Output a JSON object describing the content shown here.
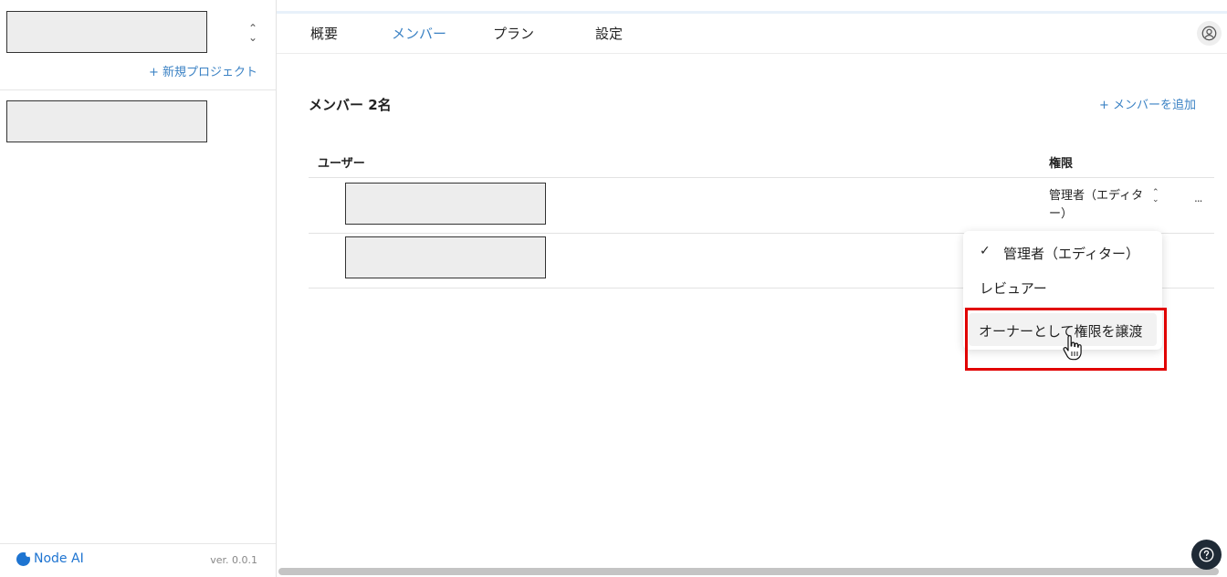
{
  "sidebar": {
    "new_project_label": "+ 新規プロジェクト",
    "logo_text": "Node AI",
    "version": "ver. 0.0.1"
  },
  "nav": {
    "tabs": [
      {
        "label": "概要",
        "active": false
      },
      {
        "label": "メンバー",
        "active": true
      },
      {
        "label": "プラン",
        "active": false
      },
      {
        "label": "設定",
        "active": false
      }
    ]
  },
  "main": {
    "members_title": "メンバー 2名",
    "add_member_label": "+ メンバーを追加",
    "columns": {
      "user": "ユーザー",
      "role": "権限"
    },
    "rows": [
      {
        "role": "管理者（エディター）",
        "more": "..."
      },
      {
        "role": ""
      }
    ]
  },
  "dropdown": {
    "items": [
      {
        "label": "管理者（エディター）",
        "checked": true
      },
      {
        "label": "レビュアー",
        "checked": false
      },
      {
        "label": "オーナーとして権限を譲渡",
        "checked": false
      }
    ],
    "check_mark": "✓"
  },
  "colors": {
    "accent": "#3b82c4",
    "highlight": "#e10000",
    "help_button": "#1f2a36"
  }
}
